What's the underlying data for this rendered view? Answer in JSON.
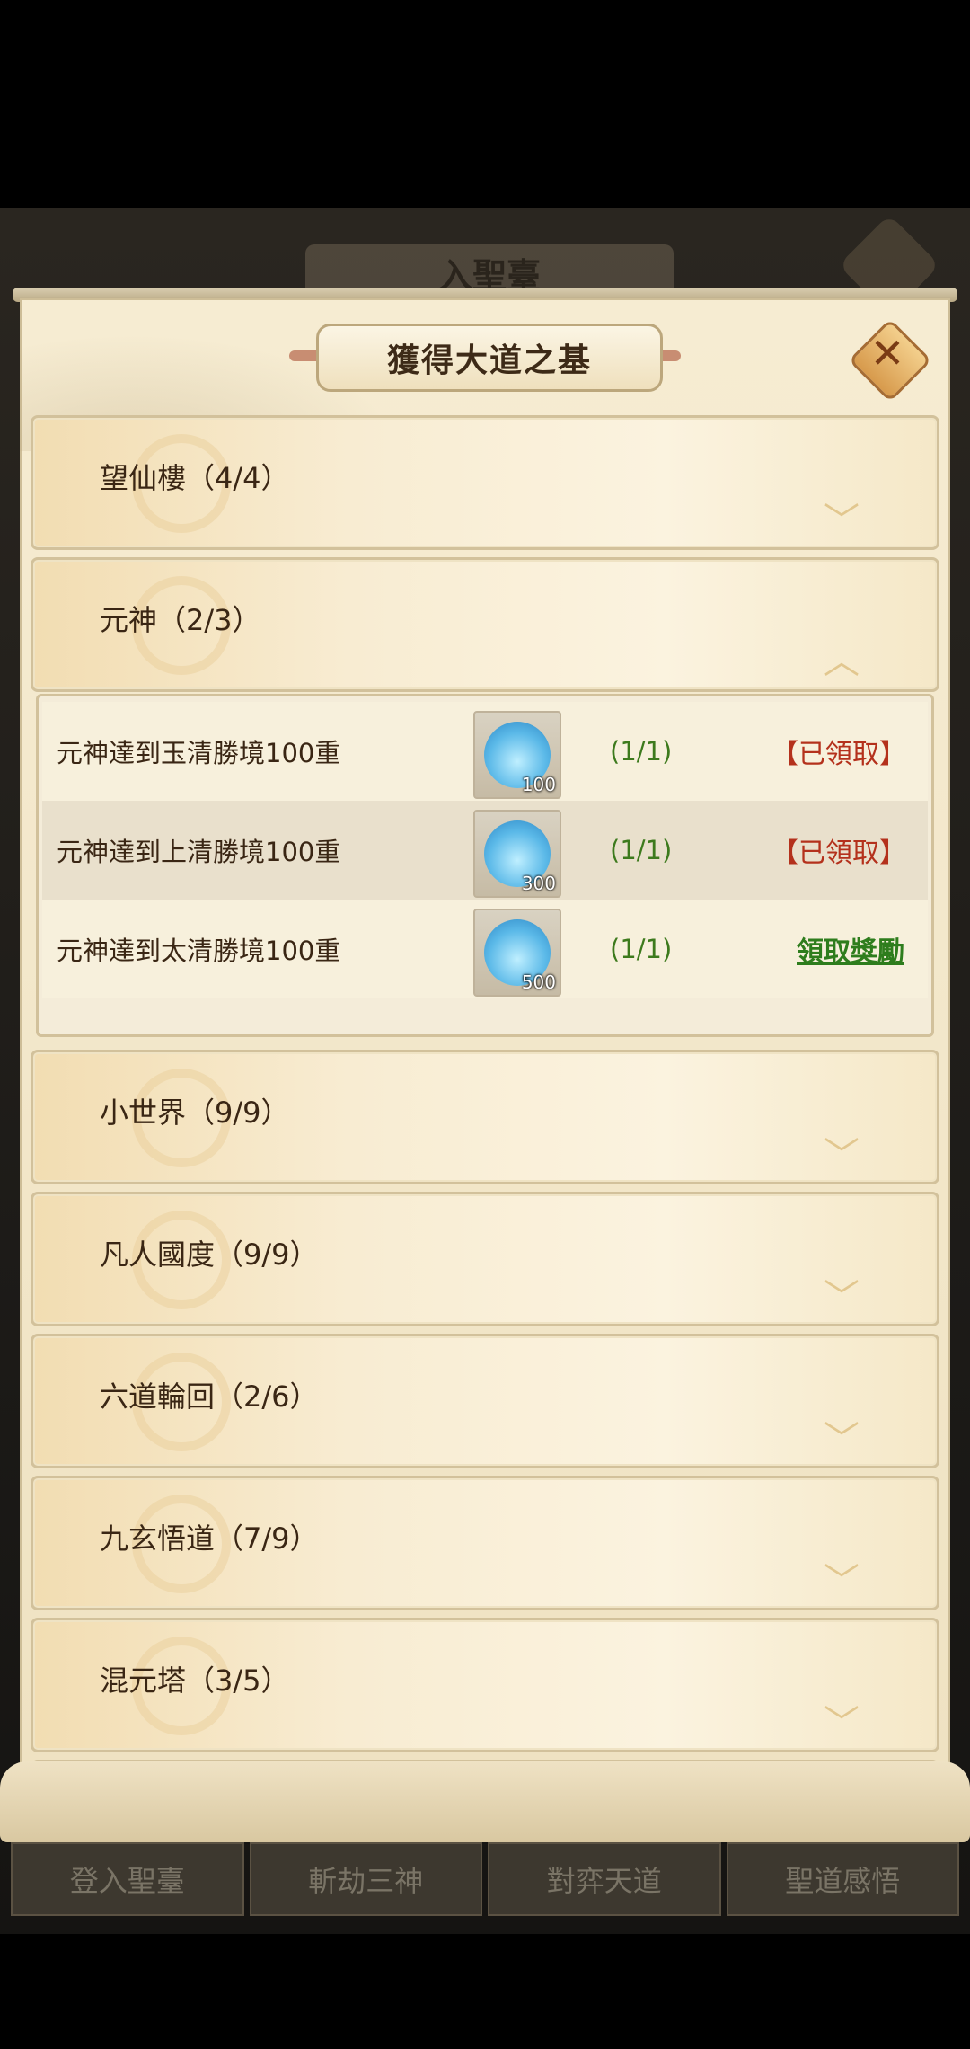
{
  "background": {
    "title": "入聖臺",
    "tabs": [
      "登入聖臺",
      "斬劫三神",
      "對弈天道",
      "聖道感悟"
    ]
  },
  "panel": {
    "title": "獲得大道之基",
    "close_icon": "close-icon"
  },
  "categories": [
    {
      "label": "望仙樓（4/4）",
      "expanded": false
    },
    {
      "label": "元神（2/3）",
      "expanded": true
    },
    {
      "label": "小世界（9/9）",
      "expanded": false
    },
    {
      "label": "凡人國度（9/9）",
      "expanded": false
    },
    {
      "label": "六道輪回（2/6）",
      "expanded": false
    },
    {
      "label": "九玄悟道（7/9）",
      "expanded": false
    },
    {
      "label": "混元塔（3/5）",
      "expanded": false
    }
  ],
  "tasks": [
    {
      "name": "元神達到玉清勝境100重",
      "reward_icon": "crystal-icon",
      "reward_count": "100",
      "progress": "(1/1)",
      "status": "【已領取】"
    },
    {
      "name": "元神達到上清勝境100重",
      "reward_icon": "crystal-icon",
      "reward_count": "300",
      "progress": "(1/1)",
      "status": "【已領取】"
    },
    {
      "name": "元神達到太清勝境100重",
      "reward_icon": "crystal-icon",
      "reward_count": "500",
      "progress": "(1/1)",
      "claim": "領取獎勵"
    }
  ]
}
